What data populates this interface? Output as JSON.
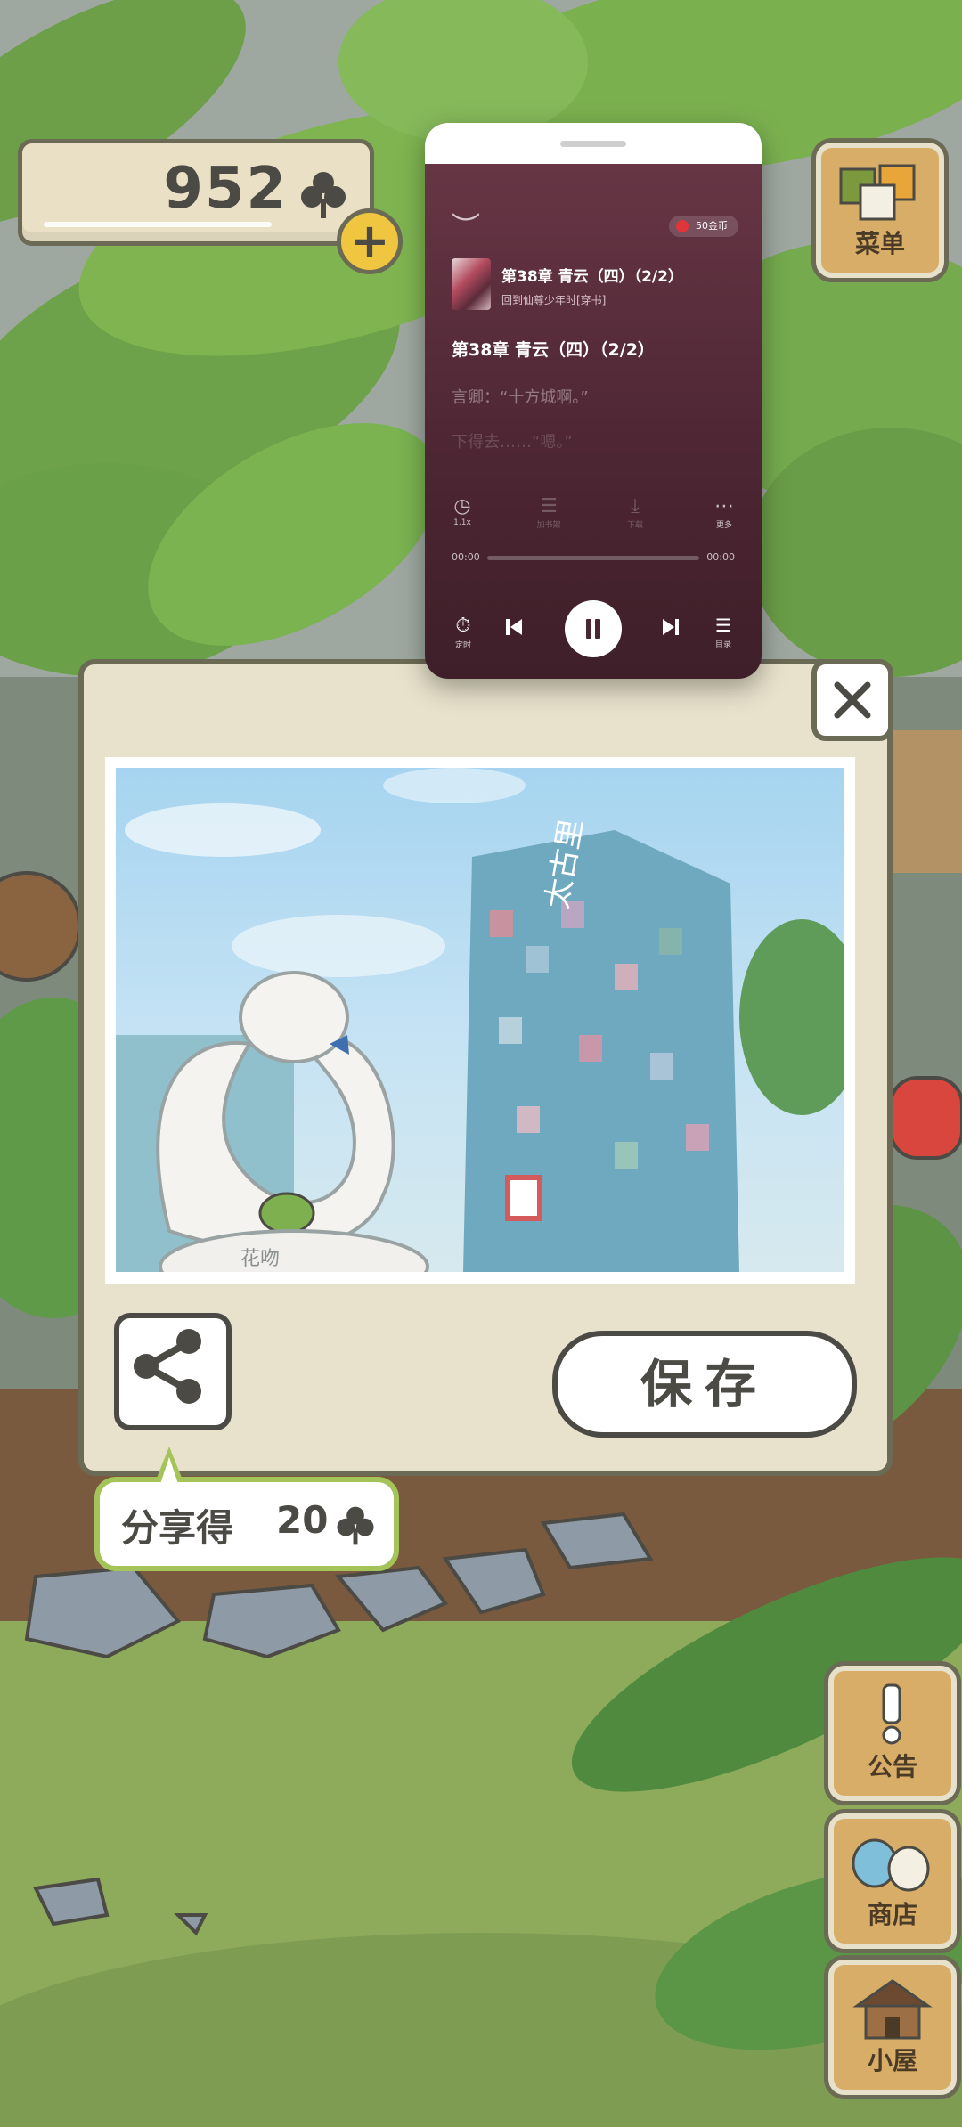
{
  "hud": {
    "clover_count": "952",
    "add_label": "+"
  },
  "side_buttons": {
    "menu": "菜单",
    "notice": "公告",
    "shop": "商店",
    "house": "小屋"
  },
  "player": {
    "coin_badge": "50金币",
    "chapter_title": "第38章 青云（四）（2/2）",
    "book_title": "回到仙尊少年时[穿书]",
    "chapter_heading": "第38章 青云（四）（2/2）",
    "lyric_line_1": "言卿：“十方城啊。”",
    "lyric_line_2": "下得去……“嗯。”",
    "tools": [
      {
        "icon": "speed-icon",
        "label": "1.1x"
      },
      {
        "icon": "bookshelf-icon",
        "label": "加书架"
      },
      {
        "icon": "download-icon",
        "label": "下载"
      },
      {
        "icon": "more-icon",
        "label": "更多"
      }
    ],
    "time_current": "00:00",
    "time_total": "00:00",
    "timer_label": "定时",
    "toc_label": "目录"
  },
  "dialog": {
    "photo_sign_text": "花吻",
    "building_sign_text": "太古里",
    "save_label": "保存",
    "share_reward_label": "分享得",
    "share_reward_amount": "20"
  },
  "colors": {
    "outline": "#6b6a55",
    "panel": "#e8e2cc",
    "wood": "#d7ad67",
    "share_green": "#a4c45a",
    "player_bg": "#4d2633"
  }
}
